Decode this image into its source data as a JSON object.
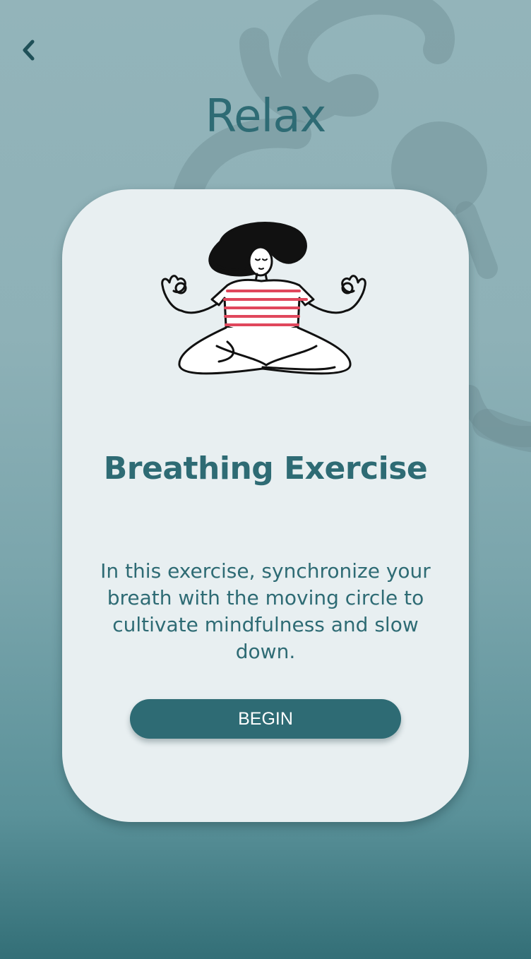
{
  "header": {
    "back_icon": "chevron-left-icon",
    "title": "Relax"
  },
  "card": {
    "illustration": "meditating-person",
    "title": "Breathing Exercise",
    "description": "In this exercise, synchronize your breath with the moving circle to cultivate mindfulness and slow down.",
    "begin_label": "BEGIN"
  },
  "colors": {
    "accent": "#2e6b74",
    "card_background": "#e8eff1",
    "stripe": "#e0475c"
  }
}
